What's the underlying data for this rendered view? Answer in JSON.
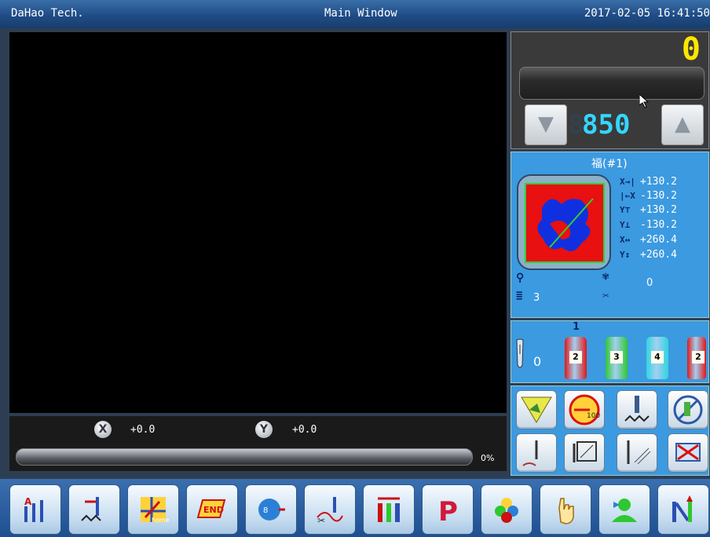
{
  "titlebar": {
    "company": "DaHao Tech.",
    "window": "Main Window",
    "datetime": "2017-02-05 16:41:50"
  },
  "position": {
    "x_value": "+0.0",
    "y_value": "+0.0",
    "progress": "0%",
    "progress_fraction": 0
  },
  "speed_panel": {
    "counter": "0",
    "speed": "850",
    "speed_ghost": "8",
    "down_label": "▼",
    "up_label": "▲"
  },
  "pattern": {
    "name": "福(#1)",
    "x_plus": "+130.2",
    "x_minus": "-130.2",
    "y_plus": "+130.2",
    "y_minus": "-130.2",
    "width": "+260.4",
    "height": "+260.4",
    "x_plus_label": "X→|",
    "x_minus_label": "|←X",
    "y_plus_label": "Y⊤",
    "y_minus_label": "Y⊥",
    "width_label": "X↔",
    "height_label": "Y↕",
    "colors_count": "3",
    "stitch_count": "0"
  },
  "needles": {
    "current": "0",
    "marker": "1",
    "spools": [
      {
        "number": "2",
        "color": "#e01818"
      },
      {
        "number": "3",
        "color": "#2ec830"
      },
      {
        "number": "4",
        "color": "#2fd4e0"
      },
      {
        "number": "2",
        "color": "#e01818"
      }
    ]
  },
  "toolbar_icons": [
    "needle-select-icon",
    "frame-offset-icon",
    "home-icon",
    "end-icon",
    "speed-dial-icon",
    "thread-trim-icon",
    "color-change-icon",
    "parameter-icon",
    "pattern-icon",
    "hand-icon",
    "user-icon",
    "needle-switch-icon"
  ],
  "toolbar": {
    "p_label": "P",
    "home_label": "home",
    "end_label": "END"
  }
}
